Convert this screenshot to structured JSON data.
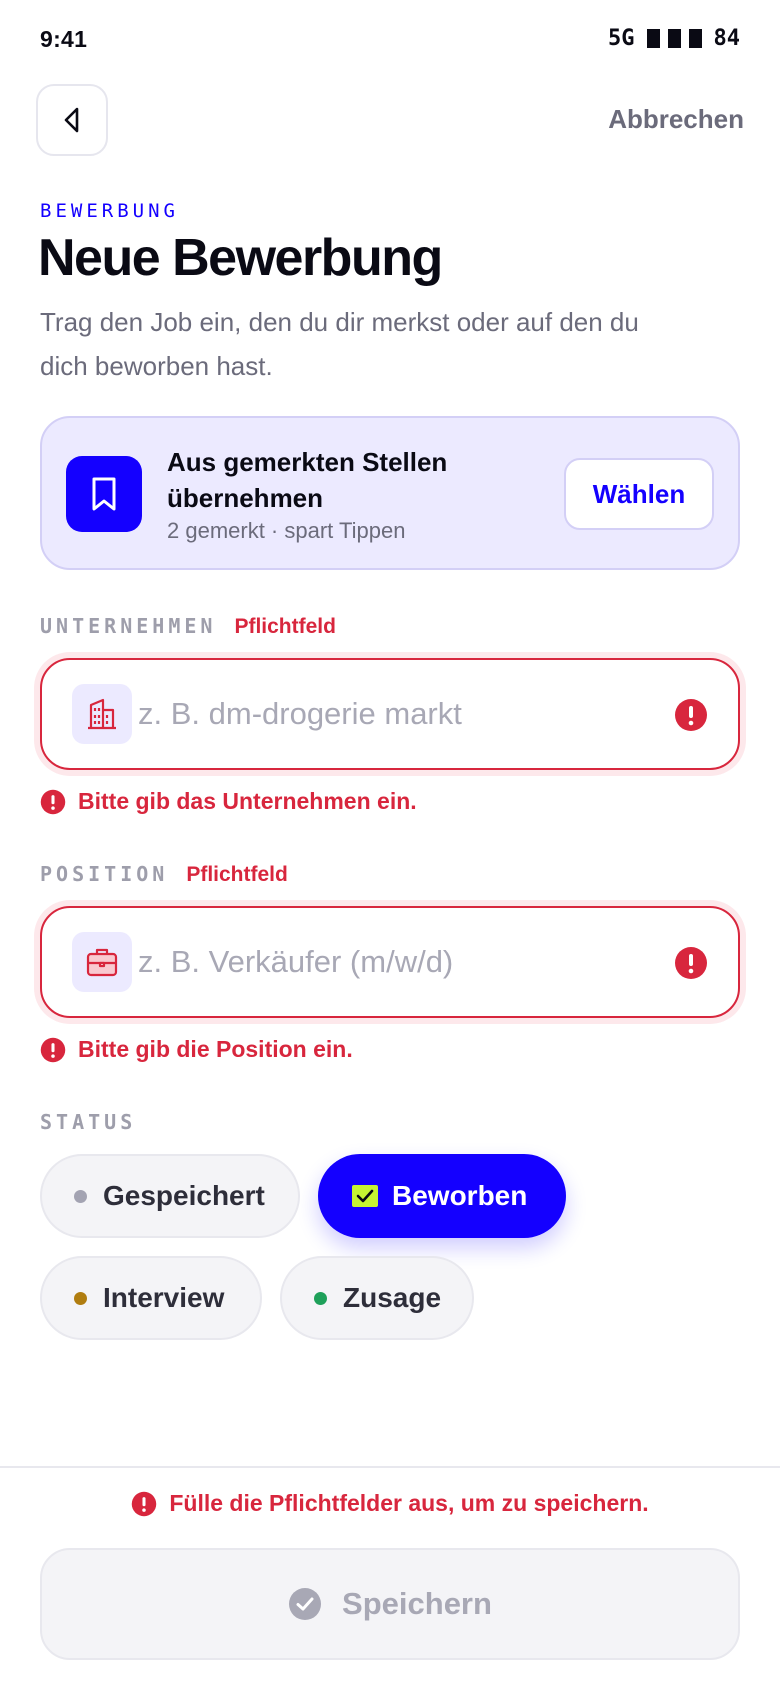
{
  "status_bar": {
    "time": "9:41",
    "network": "5G",
    "battery": "84"
  },
  "nav": {
    "cancel_label": "Abbrechen"
  },
  "header": {
    "eyebrow": "BEWERBUNG",
    "title": "Neue Bewerbung",
    "subtitle": "Trag den Job ein, den du dir merkst oder auf den du dich beworben hast."
  },
  "saved_jobs": {
    "title": "Aus gemerkten Stellen übernehmen",
    "subtitle": "2 gemerkt · spart Tippen",
    "button_label": "Wählen"
  },
  "company_field": {
    "label": "UNTERNEHMEN",
    "required_label": "Pflichtfeld",
    "value": "",
    "placeholder": "z. B. dm-drogerie markt",
    "error": "Bitte gib das Unternehmen ein."
  },
  "position_field": {
    "label": "POSITION",
    "required_label": "Pflichtfeld",
    "value": "",
    "placeholder": "z. B. Verkäufer (m/w/d)",
    "error": "Bitte gib die Position ein."
  },
  "status": {
    "label": "STATUS",
    "selected": "Beworben",
    "options": [
      {
        "label": "Gespeichert",
        "color": "#a3a3b2"
      },
      {
        "label": "Beworben",
        "color": "#c6f432"
      },
      {
        "label": "Interview",
        "color": "#b07d10"
      },
      {
        "label": "Zusage",
        "color": "#1ea05a"
      }
    ]
  },
  "footer": {
    "warning": "Fülle die Pflichtfelder aus, um zu speichern.",
    "save_label": "Speichern"
  },
  "colors": {
    "accent": "#1400ff",
    "error": "#d8263d",
    "muted": "#6b6b7b",
    "card_bg": "#eceaff"
  }
}
